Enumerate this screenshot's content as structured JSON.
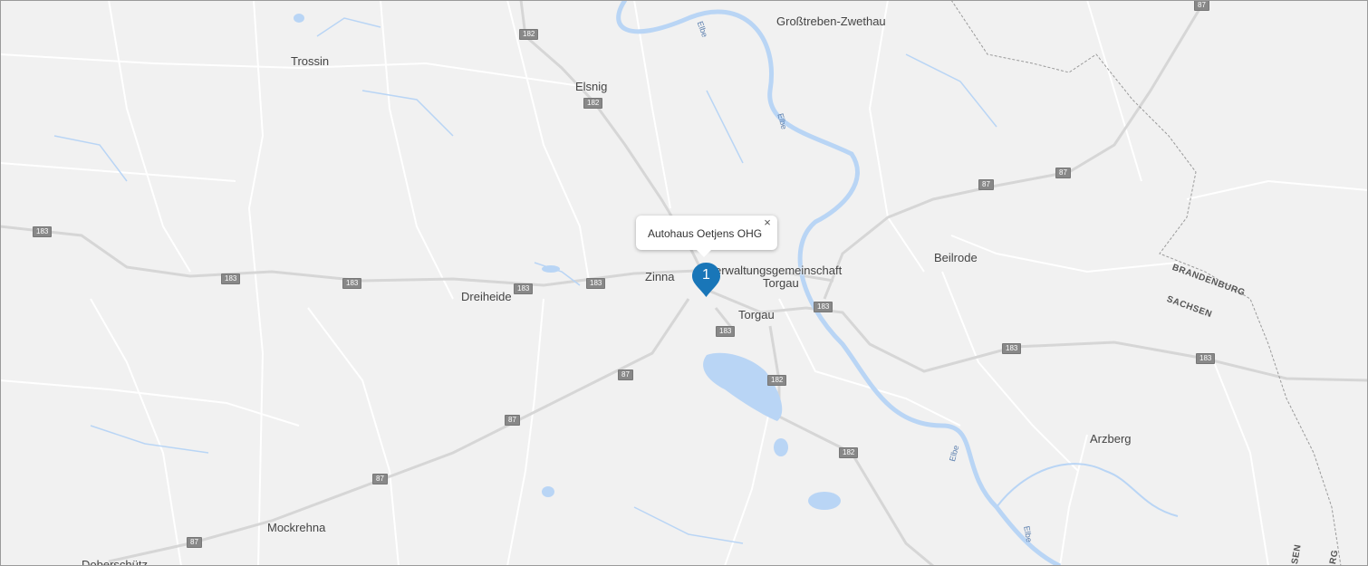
{
  "map": {
    "places": [
      {
        "id": "grosstreben",
        "name": "Großtreben-Zwethau"
      },
      {
        "id": "trossin",
        "name": "Trossin"
      },
      {
        "id": "elsnig",
        "name": "Elsnig"
      },
      {
        "id": "beilrode",
        "name": "Beilrode"
      },
      {
        "id": "zinna",
        "name": "Zinna"
      },
      {
        "id": "verwaltung",
        "name": "erwaltungsgemeinschaft"
      },
      {
        "id": "verwaltung2",
        "name": "Torgau"
      },
      {
        "id": "torgau",
        "name": "Torgau"
      },
      {
        "id": "dreiheide",
        "name": "Dreiheide"
      },
      {
        "id": "arzberg",
        "name": "Arzberg"
      },
      {
        "id": "mockrehna",
        "name": "Mockrehna"
      },
      {
        "id": "doberschuetz",
        "name": "Doberschütz"
      }
    ],
    "state_labels": [
      {
        "id": "brandenburg",
        "name": "BRANDENBURG"
      },
      {
        "id": "sachsen",
        "name": "SACHSEN"
      },
      {
        "id": "sachsen2",
        "name": "SEN"
      },
      {
        "id": "brandenburg2",
        "name": "RG"
      }
    ],
    "water_labels": [
      {
        "id": "elbe1",
        "name": "Elbe"
      },
      {
        "id": "elbe2",
        "name": "Elbe"
      },
      {
        "id": "elbe3",
        "name": "Elbe"
      },
      {
        "id": "elbe4",
        "name": "Elbe"
      }
    ],
    "road_shields": [
      "182",
      "182",
      "183",
      "183",
      "183",
      "183",
      "183",
      "183",
      "183",
      "183",
      "183",
      "182",
      "182",
      "87",
      "87",
      "87",
      "87",
      "87",
      "87",
      "87"
    ]
  },
  "info_window": {
    "title": "Autohaus Oetjens OHG",
    "close_symbol": "×"
  },
  "marker": {
    "number": "1",
    "color": "#1976b8"
  },
  "colors": {
    "land": "#f1f1f1",
    "water": "#b9d5f5",
    "road": "#ffffff",
    "major_road": "#d9d9d9",
    "shield": "#888888"
  }
}
